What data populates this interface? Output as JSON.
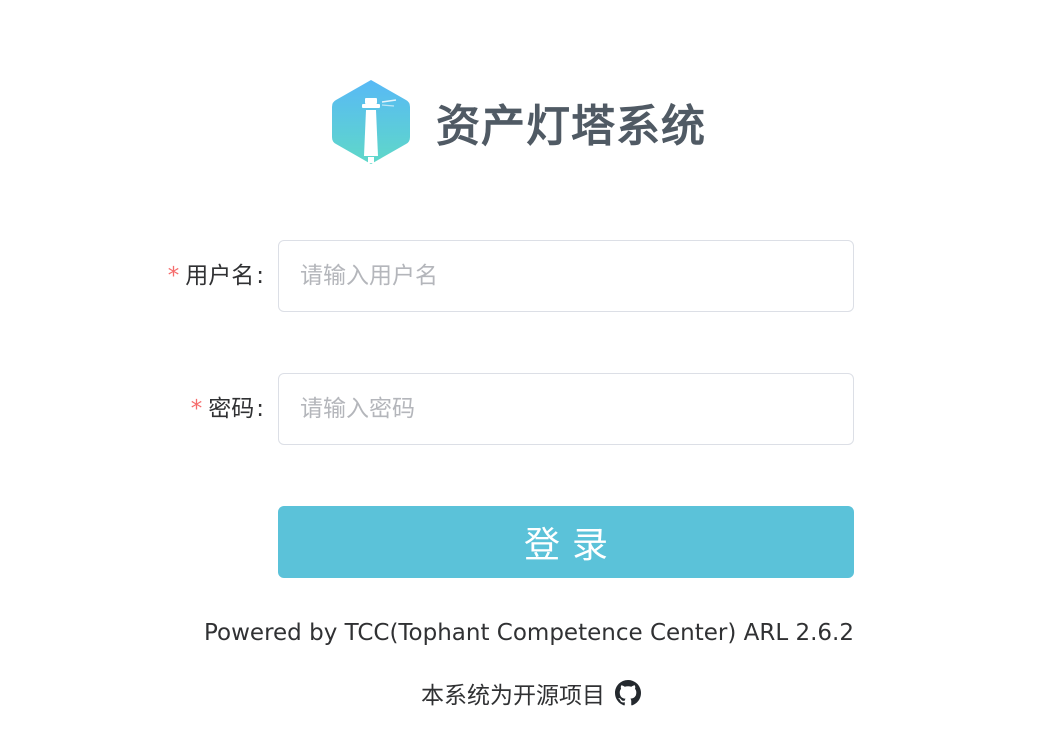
{
  "brand": {
    "title": "资产灯塔系统",
    "logo_icon": "lighthouse-hexagon-icon",
    "logo_gradient": [
      "#58b9f6",
      "#5fd8c8"
    ]
  },
  "form": {
    "username": {
      "required_mark": "*",
      "label": "用户名",
      "colon": ":",
      "placeholder": "请输入用户名",
      "value": ""
    },
    "password": {
      "required_mark": "*",
      "label": "密码",
      "colon": ":",
      "placeholder": "请输入密码",
      "value": ""
    },
    "login_label": "登录"
  },
  "footer": {
    "powered_by": "Powered by TCC(Tophant Competence Center) ARL 2.6.2",
    "open_source_text": "本系统为开源项目",
    "open_source_icon": "github-icon"
  },
  "colors": {
    "accent": "#5bc2d9",
    "required": "#f56c6c",
    "title": "#505a64",
    "text": "#303133",
    "placeholder": "#b4b6bb",
    "border": "#dcdfe6"
  }
}
